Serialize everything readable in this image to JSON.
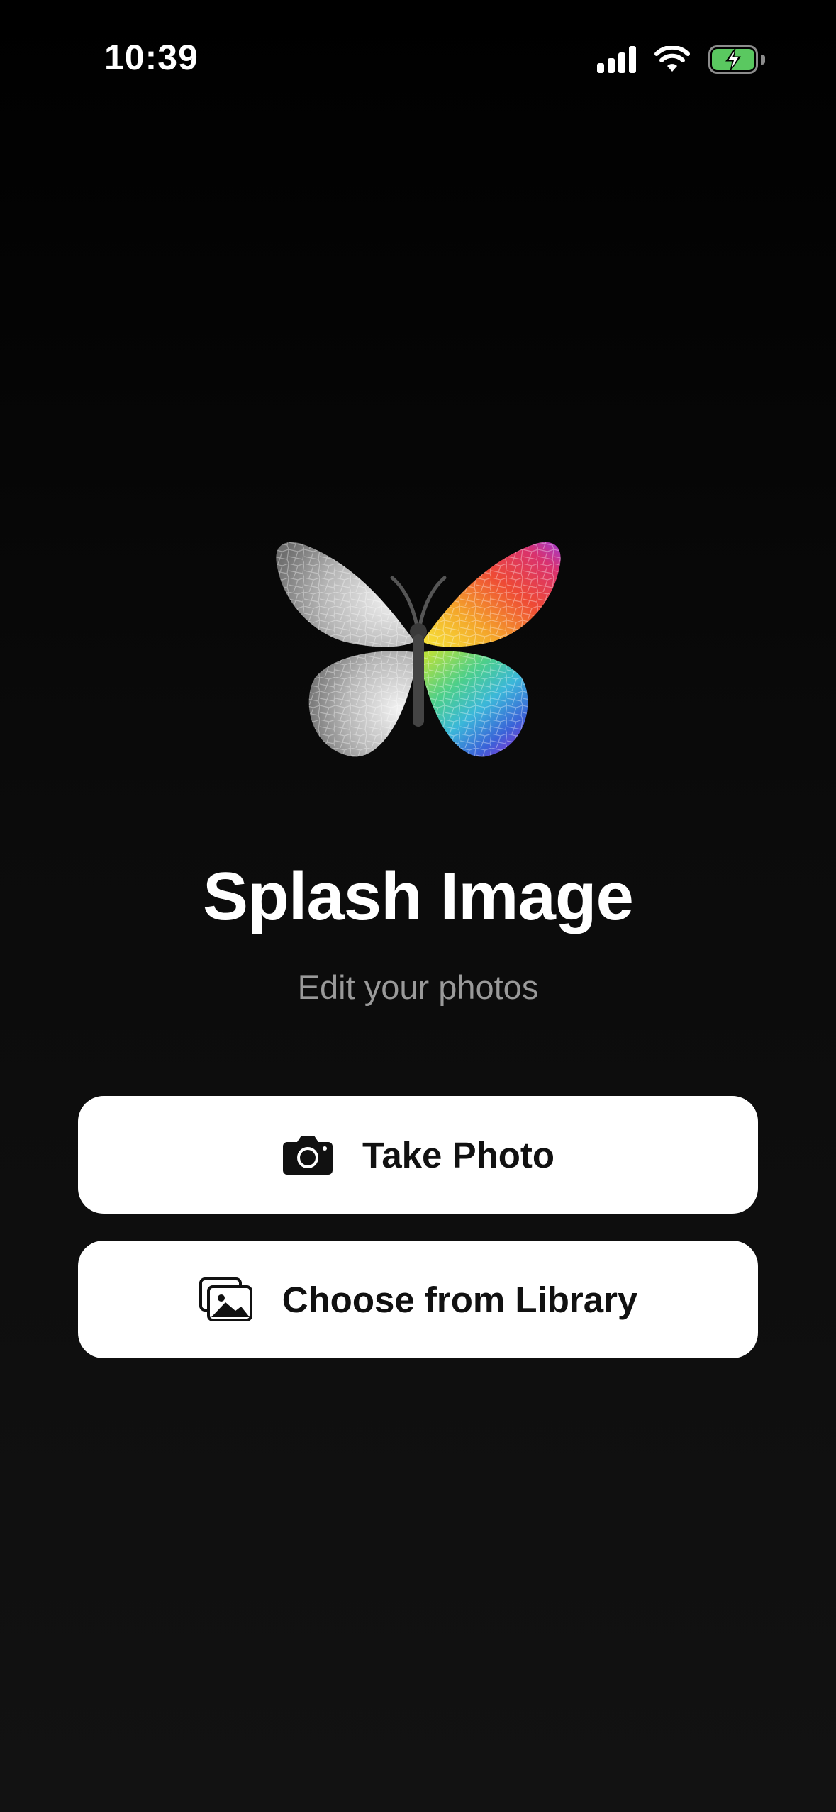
{
  "status_bar": {
    "time": "10:39",
    "icons": [
      "cellular-signal-icon",
      "wifi-icon",
      "battery-charging-icon"
    ],
    "battery_color": "#5ac860"
  },
  "app": {
    "logo_icon": "butterfly-logo",
    "title": "Splash Image",
    "subtitle": "Edit your photos"
  },
  "actions": {
    "take_photo": {
      "label": "Take Photo",
      "icon": "camera-icon"
    },
    "choose_library": {
      "label": "Choose from Library",
      "icon": "photo-library-icon"
    }
  },
  "colors": {
    "background": "#000000",
    "button_bg": "#ffffff",
    "subtitle": "#9a9a9a"
  }
}
